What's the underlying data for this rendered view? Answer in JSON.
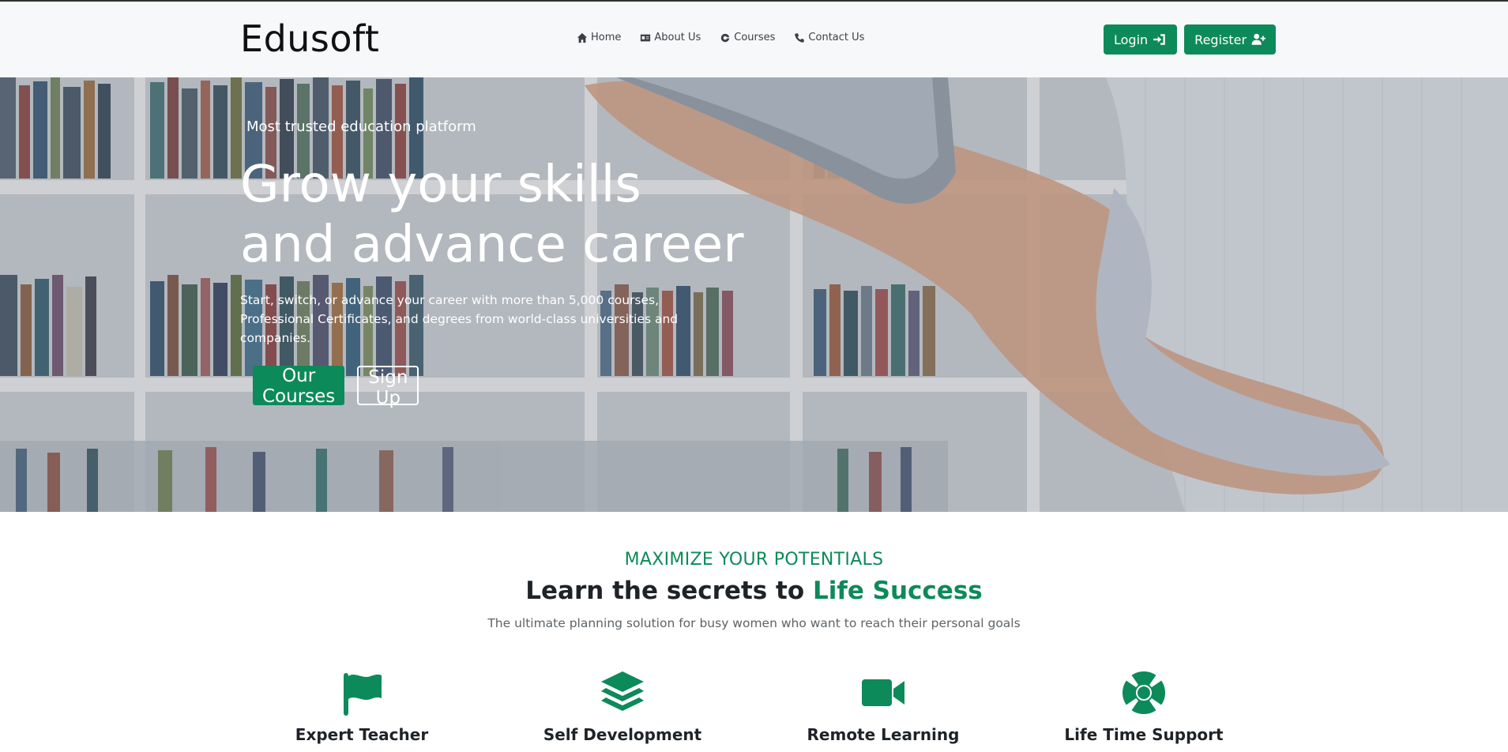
{
  "navbar": {
    "brand": "Edusoft",
    "links": [
      {
        "label": "Home",
        "icon": "home-icon"
      },
      {
        "label": "About Us",
        "icon": "id-card-icon"
      },
      {
        "label": "Courses",
        "icon": "google-icon"
      },
      {
        "label": "Contact Us",
        "icon": "phone-icon"
      }
    ],
    "login_label": "Login",
    "register_label": "Register"
  },
  "hero": {
    "kicker": "Most trusted education platform",
    "title": "Grow your skills and advance career",
    "description": "Start, switch, or advance your career with more than 5,000 courses, Professional Certificates, and degrees from world-class universities and companies.",
    "primary_cta": "Our Courses",
    "secondary_cta": "Sign Up"
  },
  "section": {
    "kicker": "MAXIMIZE YOUR POTENTIALS",
    "heading_prefix": "Learn the secrets to ",
    "heading_accent": "Life Success",
    "subtext": "The ultimate planning solution for busy women who want to reach their personal goals",
    "features": [
      {
        "label": "Expert Teacher",
        "icon": "flag-icon"
      },
      {
        "label": "Self Development",
        "icon": "layers-icon"
      },
      {
        "label": "Remote Learning",
        "icon": "video-camera-icon"
      },
      {
        "label": "Life Time Support",
        "icon": "life-ring-icon"
      }
    ]
  },
  "colors": {
    "accent": "#0d8a5a",
    "navbar_bg": "#f7f8fa"
  }
}
